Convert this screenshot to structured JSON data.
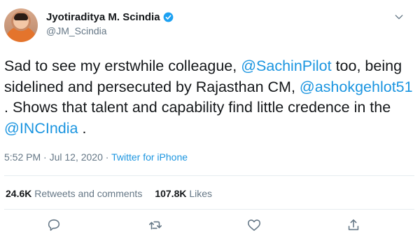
{
  "author": {
    "display_name": "Jyotiraditya M. Scindia",
    "handle": "@JM_Scindia"
  },
  "tweet": {
    "seg1": "Sad to see my erstwhile colleague, ",
    "mention1": "@SachinPilot",
    "seg2": " too, being sidelined and persecuted by Rajasthan CM, ",
    "mention2": "@ashokgehlot51",
    "seg3": " . Shows that talent and capability find little credence in the ",
    "mention3": "@INCIndia",
    "seg4": " ."
  },
  "meta": {
    "timestamp": "5:52 PM · Jul 12, 2020",
    "separator": " · ",
    "source": "Twitter for iPhone"
  },
  "stats": {
    "retweets_count": "24.6K",
    "retweets_label": "Retweets and comments",
    "likes_count": "107.8K",
    "likes_label": "Likes"
  },
  "icons": {
    "verified": "verified-badge-icon",
    "more": "chevron-down-icon",
    "reply": "reply-icon",
    "retweet": "retweet-icon",
    "like": "heart-icon",
    "share": "share-icon"
  },
  "colors": {
    "link": "#1b95e0",
    "secondary_text": "#657786",
    "primary_text": "#14171a",
    "divider": "#e6ecf0"
  }
}
